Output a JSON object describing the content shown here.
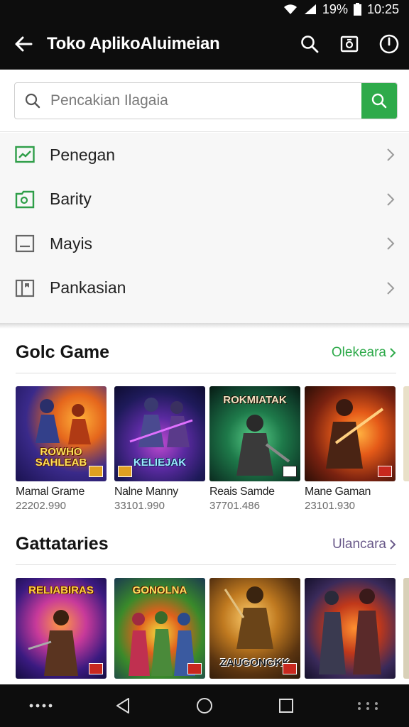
{
  "status": {
    "battery": "19%",
    "time": "10:25"
  },
  "appbar": {
    "title": "Toko AplikoAluimeian"
  },
  "search": {
    "placeholder": "Pencakian Ilagaia"
  },
  "menu": [
    {
      "label": "Penegan",
      "icon": "trend-chart-icon"
    },
    {
      "label": "Barity",
      "icon": "folder-image-icon"
    },
    {
      "label": "Mayis",
      "icon": "tablet-icon"
    },
    {
      "label": "Pankasian",
      "icon": "bookmark-tag-icon"
    }
  ],
  "section1": {
    "title": "Golc Game",
    "more": "Olekeara",
    "more_color": "#2eaa4a",
    "cards": [
      {
        "art": "ROWHO SAHLEAB",
        "name": "Mamal Grame",
        "sub": "22202.990"
      },
      {
        "art": "KELIEJAK",
        "name": "Nalne Manny",
        "sub": "33101.990"
      },
      {
        "art": "ROKMIATAK",
        "name": "Reais Samde",
        "sub": "37701.486"
      },
      {
        "art": "",
        "name": "Mane Gaman",
        "sub": "23101.930"
      }
    ]
  },
  "section2": {
    "title": "Gattataries",
    "more": "Ulancara",
    "more_color": "#6a5a8a",
    "cards": [
      {
        "art": "RELIABIRAS"
      },
      {
        "art": "GONOLNA"
      },
      {
        "art": "ZAUGONGKK"
      },
      {
        "art": ""
      }
    ]
  },
  "colors": {
    "accent": "#2eaa4a",
    "bar": "#0d0d0d"
  }
}
